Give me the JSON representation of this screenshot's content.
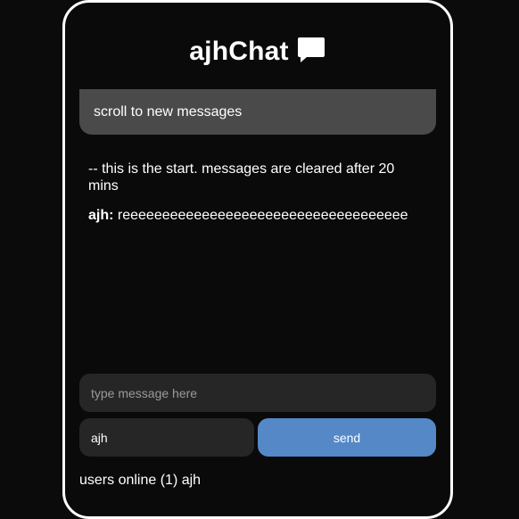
{
  "app": {
    "title": "ajhChat",
    "title_icon": "chat-bubble-icon"
  },
  "banner": {
    "text": "scroll to new messages"
  },
  "messages": [
    {
      "author": "",
      "text": "-- this is the start. messages are cleared after 20 mins"
    },
    {
      "author": "ajh:",
      "text": "reeeeeeeeeeeeeeeeeeeeeeeeeeeeeeeeeeee"
    }
  ],
  "composer": {
    "message_placeholder": "type message here",
    "message_value": "",
    "name_value": "ajh",
    "send_label": "send"
  },
  "users": {
    "text": "users online (1) ajh"
  },
  "colors": {
    "background": "#0b0b0b",
    "banner": "#4a4a4a",
    "input": "#262626",
    "send_button": "#5588c7",
    "frame_border": "#ffffff"
  }
}
